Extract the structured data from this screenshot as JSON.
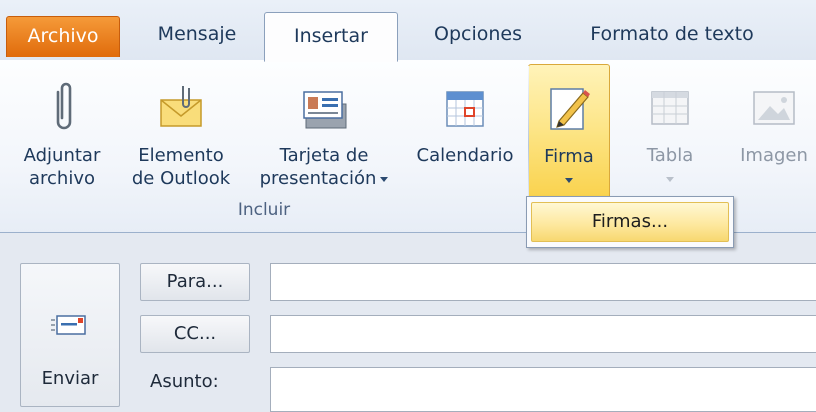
{
  "tabs": {
    "file": "Archivo",
    "message": "Mensaje",
    "insert": "Insertar",
    "options": "Opciones",
    "format": "Formato de texto"
  },
  "ribbon": {
    "attach": {
      "line1": "Adjuntar",
      "line2": "archivo",
      "icon": "paperclip-icon"
    },
    "outlook_item": {
      "line1": "Elemento",
      "line2": "de Outlook",
      "icon": "envelope-attach-icon"
    },
    "business_card": {
      "line1": "Tarjeta de",
      "line2": "presentación",
      "icon": "business-card-icon"
    },
    "calendar": {
      "label": "Calendario",
      "icon": "calendar-icon"
    },
    "signature": {
      "label": "Firma",
      "icon": "signature-pencil-icon"
    },
    "table": {
      "label": "Tabla",
      "icon": "table-icon"
    },
    "image": {
      "label": "Imagen",
      "icon": "picture-icon"
    },
    "group_label": "Incluir"
  },
  "dropdown": {
    "item": "Firmas..."
  },
  "form": {
    "send": "Enviar",
    "to": "Para...",
    "cc": "CC...",
    "subject": "Asunto:"
  },
  "colors": {
    "file_tab": "#e97417",
    "hover": "#fde68a",
    "ribbon_text": "#1e395b"
  }
}
